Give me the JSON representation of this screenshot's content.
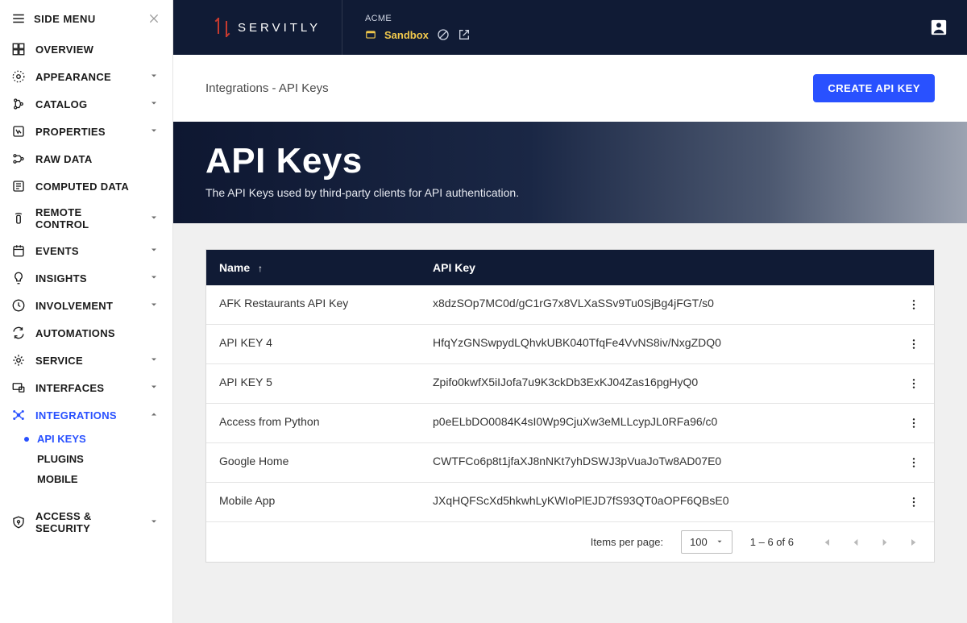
{
  "sidebar": {
    "title": "SIDE MENU",
    "items": [
      {
        "key": "overview",
        "label": "OVERVIEW",
        "expandable": false
      },
      {
        "key": "appearance",
        "label": "APPEARANCE",
        "expandable": true
      },
      {
        "key": "catalog",
        "label": "CATALOG",
        "expandable": true
      },
      {
        "key": "properties",
        "label": "PROPERTIES",
        "expandable": true
      },
      {
        "key": "raw-data",
        "label": "RAW DATA",
        "expandable": false
      },
      {
        "key": "computed-data",
        "label": "COMPUTED DATA",
        "expandable": false
      },
      {
        "key": "remote-control",
        "label": "REMOTE CONTROL",
        "expandable": true
      },
      {
        "key": "events",
        "label": "EVENTS",
        "expandable": true
      },
      {
        "key": "insights",
        "label": "INSIGHTS",
        "expandable": true
      },
      {
        "key": "involvement",
        "label": "INVOLVEMENT",
        "expandable": true
      },
      {
        "key": "automations",
        "label": "AUTOMATIONS",
        "expandable": false
      },
      {
        "key": "service",
        "label": "SERVICE",
        "expandable": true
      },
      {
        "key": "interfaces",
        "label": "INTERFACES",
        "expandable": true
      },
      {
        "key": "integrations",
        "label": "INTEGRATIONS",
        "expandable": true,
        "active": true,
        "children": [
          {
            "key": "api-keys",
            "label": "API KEYS",
            "active": true
          },
          {
            "key": "plugins",
            "label": "PLUGINS"
          },
          {
            "key": "mobile",
            "label": "MOBILE"
          }
        ]
      },
      {
        "key": "access-security",
        "label": "ACCESS & SECURITY",
        "expandable": true,
        "spacedTop": true
      }
    ]
  },
  "header": {
    "brand": "SERVITLY",
    "tenant": "ACME",
    "env_label": "Sandbox"
  },
  "crumb": {
    "text": "Integrations - API Keys"
  },
  "actions": {
    "create_label": "CREATE API KEY"
  },
  "hero": {
    "title": "API Keys",
    "subtitle": "The API Keys used by third-party clients for API authentication."
  },
  "table": {
    "columns": {
      "name": "Name",
      "key": "API Key"
    },
    "sort": {
      "col": "name",
      "dir": "asc",
      "indicator": "↑"
    },
    "rows": [
      {
        "name": "AFK Restaurants API Key",
        "key": "x8dzSOp7MC0d/gC1rG7x8VLXaSSv9Tu0SjBg4jFGT/s0"
      },
      {
        "name": "API KEY 4",
        "key": "HfqYzGNSwpydLQhvkUBK040TfqFe4VvNS8iv/NxgZDQ0"
      },
      {
        "name": "API KEY 5",
        "key": "Zpifo0kwfX5iIJofa7u9K3ckDb3ExKJ04Zas16pgHyQ0"
      },
      {
        "name": "Access from Python",
        "key": "p0eELbDO0084K4sI0Wp9CjuXw3eMLLcypJL0RFa96/c0"
      },
      {
        "name": "Google Home",
        "key": "CWTFCo6p8t1jfaXJ8nNKt7yhDSWJ3pVuaJoTw8AD07E0"
      },
      {
        "name": "Mobile App",
        "key": "JXqHQFScXd5hkwhLyKWIoPlEJD7fS93QT0aOPF6QBsE0"
      }
    ],
    "footer": {
      "items_per_page_label": "Items per page:",
      "items_per_page_value": "100",
      "range_text": "1 – 6 of 6"
    }
  }
}
